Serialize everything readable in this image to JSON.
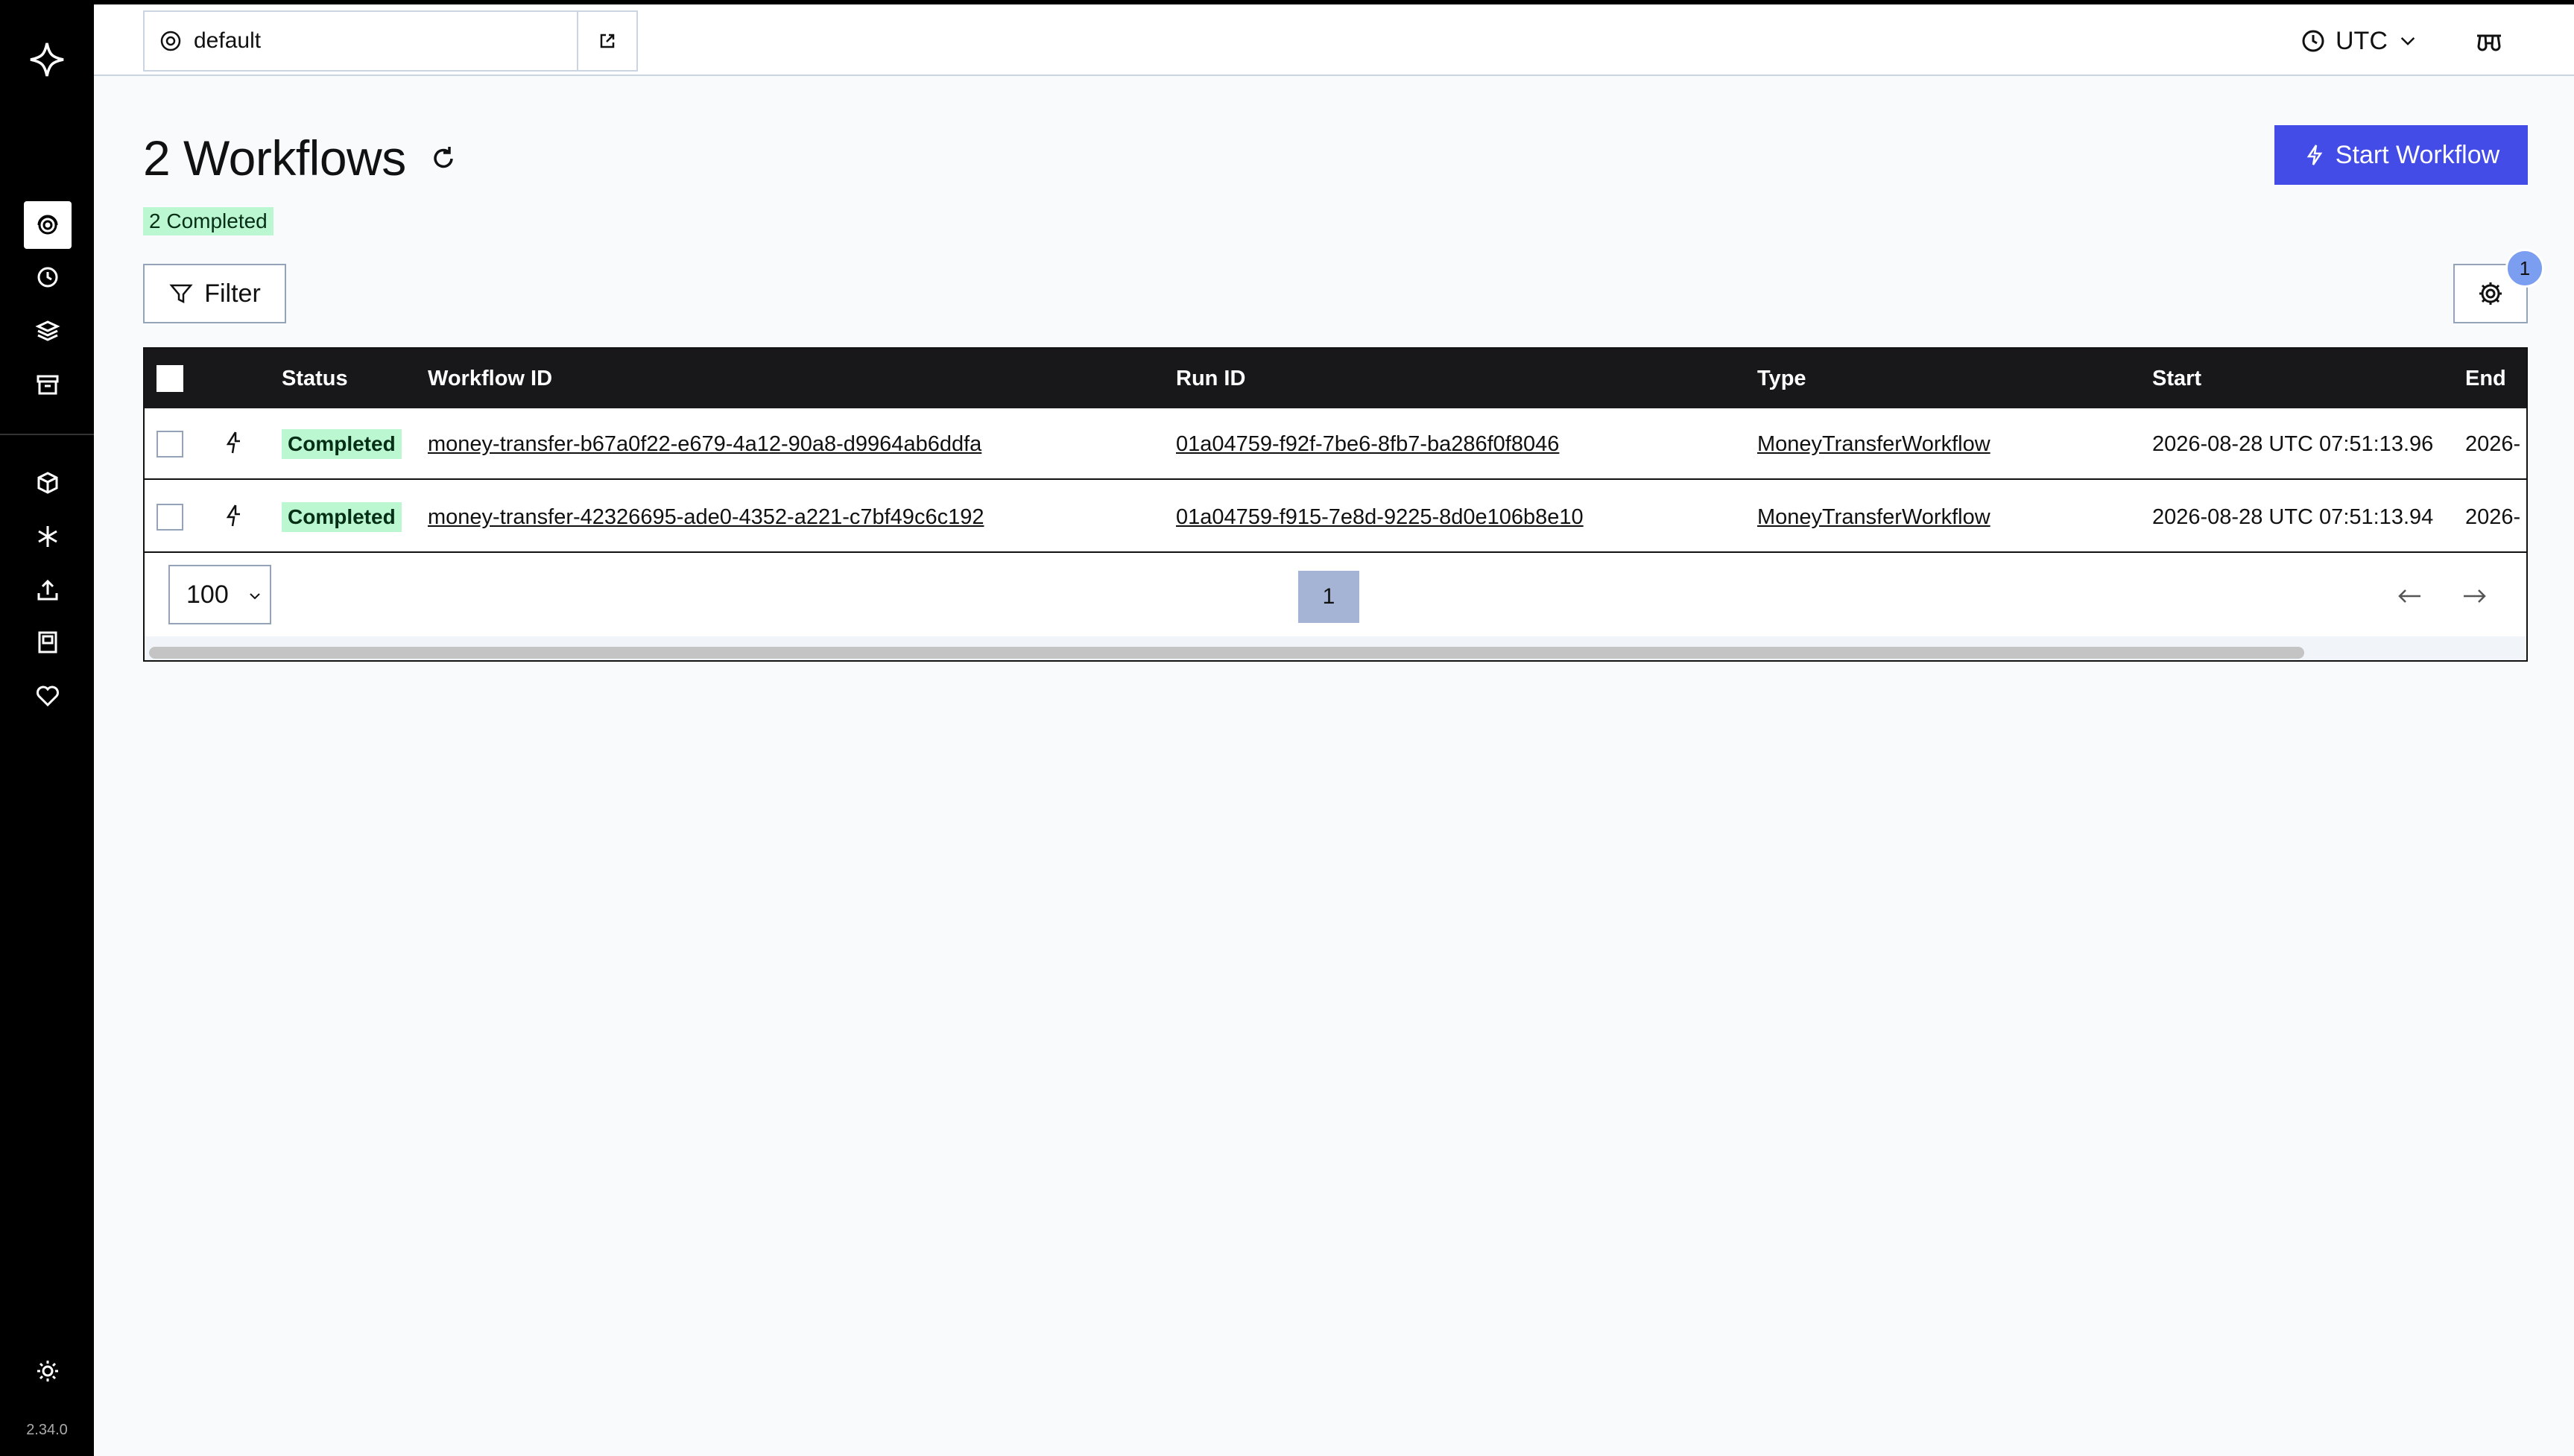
{
  "app": {
    "version": "2.34.0"
  },
  "sidebar": {
    "items": [
      {
        "icon": "workflows-icon",
        "active": true
      },
      {
        "icon": "schedules-icon"
      },
      {
        "icon": "batch-operations-icon"
      },
      {
        "icon": "archive-icon"
      },
      {
        "icon": "namespaces-icon"
      },
      {
        "icon": "nexus-icon"
      },
      {
        "icon": "import-icon"
      },
      {
        "icon": "docs-icon"
      },
      {
        "icon": "feedback-icon"
      }
    ],
    "theme_icon": "sun-icon"
  },
  "header": {
    "namespace": "default",
    "timezone": "UTC"
  },
  "page": {
    "title": "2 Workflows",
    "count_badge": "2 Completed",
    "start_button": "Start Workflow",
    "filter_button": "Filter",
    "configure_badge": "1"
  },
  "table": {
    "columns": [
      "Status",
      "Workflow ID",
      "Run ID",
      "Type",
      "Start",
      "End"
    ],
    "rows": [
      {
        "status": "Completed",
        "workflow_id": "money-transfer-b67a0f22-e679-4a12-90a8-d9964ab6ddfa",
        "run_id": "01a04759-f92f-7be6-8fb7-ba286f0f8046",
        "type": "MoneyTransferWorkflow",
        "start": "2026-08-28 UTC 07:51:13.96",
        "end": "2026-"
      },
      {
        "status": "Completed",
        "workflow_id": "money-transfer-42326695-ade0-4352-a221-c7bf49c6c192",
        "run_id": "01a04759-f915-7e8d-9225-8d0e106b8e10",
        "type": "MoneyTransferWorkflow",
        "start": "2026-08-28 UTC 07:51:13.94",
        "end": "2026-"
      }
    ]
  },
  "pagination": {
    "page_size": "100",
    "current_page": "1"
  },
  "colors": {
    "primary": "#444ce7",
    "completed_bg": "#bbf7d0",
    "sidebar_bg": "#000000"
  }
}
